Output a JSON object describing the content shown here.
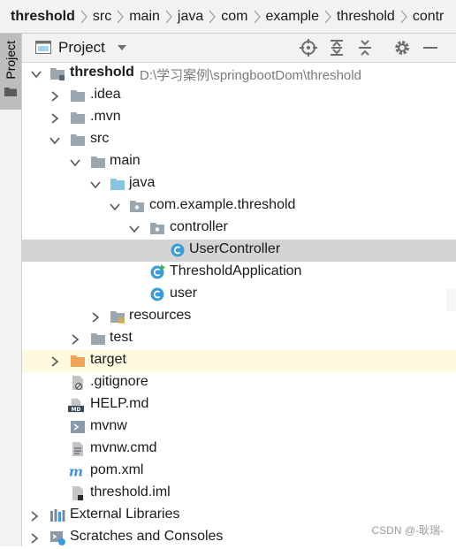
{
  "breadcrumb": [
    "threshold",
    "src",
    "main",
    "java",
    "com",
    "example",
    "threshold",
    "contr"
  ],
  "tool_stripe": {
    "label": "Project"
  },
  "panel": {
    "title": "Project",
    "toolbar": [
      "crosshair-icon",
      "expand-all-icon",
      "collapse-all-icon",
      "gear-icon",
      "minimize-icon"
    ]
  },
  "tree": {
    "root": {
      "name": "threshold",
      "path": "D:\\学习案例\\springbootDom\\threshold"
    },
    "items": [
      {
        "label": "threshold"
      },
      {
        "label": ".idea"
      },
      {
        "label": ".mvn"
      },
      {
        "label": "src"
      },
      {
        "label": "main"
      },
      {
        "label": "java"
      },
      {
        "label": "com.example.threshold"
      },
      {
        "label": "controller"
      },
      {
        "label": "UserController"
      },
      {
        "label": "ThresholdApplication"
      },
      {
        "label": "user"
      },
      {
        "label": "resources"
      },
      {
        "label": "test"
      },
      {
        "label": "target"
      },
      {
        "label": ".gitignore"
      },
      {
        "label": "HELP.md"
      },
      {
        "label": "mvnw"
      },
      {
        "label": "mvnw.cmd"
      },
      {
        "label": "pom.xml"
      },
      {
        "label": "threshold.iml"
      },
      {
        "label": "External Libraries"
      },
      {
        "label": "Scratches and Consoles"
      }
    ]
  },
  "watermark": "CSDN @-耿瑞-",
  "colors": {
    "selected_row": "#d4d4d4",
    "excluded_row": "#fefae0",
    "class_icon": "#3d9bd8",
    "java_source_folder": "#86c6e3",
    "excluded_folder": "#f0a35b"
  }
}
